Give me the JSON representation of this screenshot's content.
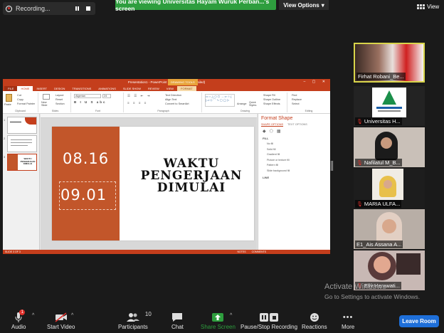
{
  "recording": {
    "label": "Recording...",
    "pause_icon": "pause-icon",
    "stop_icon": "stop-icon"
  },
  "banner": {
    "text": "You are viewing Universitas Hayam Wuruk Perban...'s screen"
  },
  "view_options": {
    "label": "View Options",
    "chevron": "▾"
  },
  "view": {
    "label": "View"
  },
  "ppt": {
    "title": "Presentation1 - PowerPoint (Product Activation Failed)",
    "drawing_tools": "DRAWING TOOLS",
    "tabs": [
      "FILE",
      "HOME",
      "INSERT",
      "DESIGN",
      "TRANSITIONS",
      "ANIMATIONS",
      "SLIDE SHOW",
      "REVIEW",
      "VIEW",
      "FORMAT"
    ],
    "ribbon": {
      "clipboard": {
        "paste": "Paste",
        "cut": "Cut",
        "copy": "Copy",
        "format_painter": "Format Painter",
        "label": "Clipboard"
      },
      "slides": {
        "new_slide": "New Slide",
        "layout": "Layout",
        "reset": "Reset",
        "section": "Section",
        "label": "Slides"
      },
      "font": {
        "name": "Algerian",
        "size": "24",
        "label": "Font"
      },
      "paragraph": {
        "text_direction": "Text Direction",
        "align_text": "Align Text",
        "smartart": "Convert to SmartArt",
        "label": "Paragraph"
      },
      "drawing": {
        "arrange": "Arrange",
        "quick_styles": "Quick Styles",
        "shape_fill": "Shape Fill",
        "shape_outline": "Shape Outline",
        "shape_effects": "Shape Effects",
        "label": "Drawing"
      },
      "editing": {
        "find": "Find",
        "replace": "Replace",
        "select": "Select",
        "label": "Editing"
      }
    },
    "thumbs": [
      {
        "num": "1"
      },
      {
        "num": "2"
      },
      {
        "num": "3",
        "text": "WAKTU PENGERJAAN DIMULAI"
      }
    ],
    "slide": {
      "time_a": "08.16",
      "time_b": "09.01",
      "title_lines": [
        "WAKTU",
        "PENGERJAAN",
        "DIMULAI"
      ]
    },
    "format_pane": {
      "title": "Format Shape",
      "tabs": [
        "SHAPE OPTIONS",
        "TEXT OPTIONS"
      ],
      "fill_label": "FILL",
      "fill_options": [
        "No fill",
        "Solid fill",
        "Gradient fill",
        "Picture or texture fill",
        "Pattern fill",
        "Slide background fill"
      ],
      "line_label": "LINE"
    },
    "status": {
      "slide_info": "SLIDE 3 OF 3",
      "notes": "NOTES",
      "comments": "COMMENTS"
    }
  },
  "participants": [
    {
      "name": "Firhat Robani_Be...",
      "muted": false
    },
    {
      "name": "Universitas H...",
      "muted": true
    },
    {
      "name": "Nafilatul M_B...",
      "muted": true
    },
    {
      "name": "MARIA ULFA...",
      "muted": true
    },
    {
      "name": "E1_Ais Assana A...",
      "muted": false
    },
    {
      "name": "Elly Herawati...",
      "muted": true
    }
  ],
  "watermark": {
    "line1": "Activate Windows",
    "line2": "Go to Settings to activate Windows."
  },
  "toolbar": {
    "audio": "Audio",
    "audio_badge": "1",
    "start_video": "Start Video",
    "participants": "Participants",
    "participants_count": "10",
    "chat": "Chat",
    "share_screen": "Share Screen",
    "record": "Pause/Stop Recording",
    "reactions": "Reactions",
    "more": "More",
    "leave": "Leave Room"
  },
  "colors": {
    "accent_green": "#2e9e3e",
    "ppt_orange": "#c43e1c",
    "slide_orange": "#c2562a",
    "leave_blue": "#1e6fd9",
    "mute_red": "#e0302b"
  }
}
